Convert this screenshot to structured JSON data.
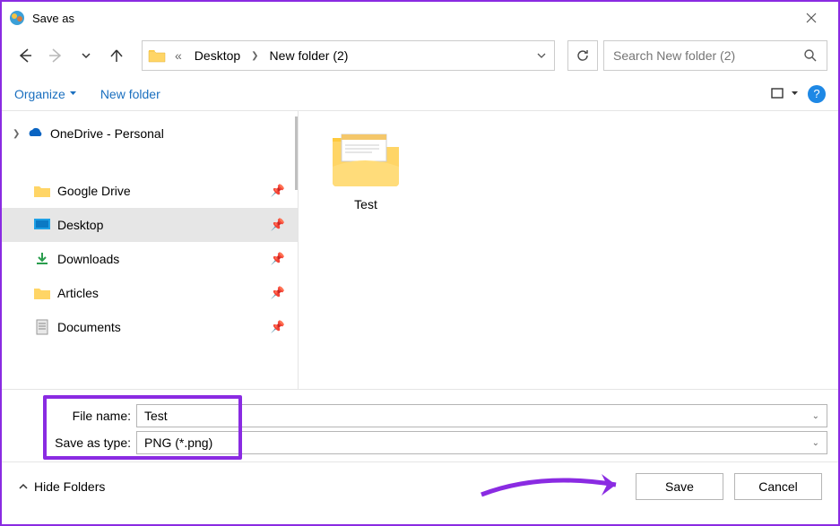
{
  "titlebar": {
    "title": "Save as"
  },
  "nav": {
    "crumb_sep": "«",
    "crumb1": "Desktop",
    "crumb2": "New folder (2)"
  },
  "search": {
    "placeholder": "Search New folder (2)"
  },
  "toolbar": {
    "organize": "Organize",
    "newfolder": "New folder"
  },
  "tree": {
    "onedrive": "OneDrive - Personal",
    "items": [
      {
        "label": "Google Drive",
        "icon": "folder-yellow"
      },
      {
        "label": "Desktop",
        "icon": "desktop-blue",
        "selected": true
      },
      {
        "label": "Downloads",
        "icon": "download-green"
      },
      {
        "label": "Articles",
        "icon": "folder-yellow"
      },
      {
        "label": "Documents",
        "icon": "document"
      }
    ]
  },
  "content": {
    "items": [
      {
        "name": "Test"
      }
    ]
  },
  "fields": {
    "filename_label": "File name:",
    "filename_value": "Test",
    "savetype_label": "Save as type:",
    "savetype_value": "PNG (*.png)"
  },
  "footer": {
    "hide_folders": "Hide Folders",
    "save": "Save",
    "cancel": "Cancel"
  }
}
